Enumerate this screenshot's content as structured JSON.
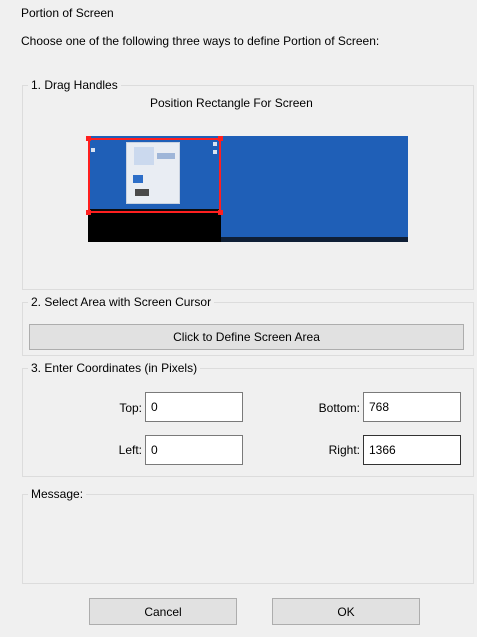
{
  "window": {
    "title": "Portion of Screen",
    "instruction": "Choose one of the following three ways to define Portion of Screen:"
  },
  "drag_handles": {
    "legend": "1. Drag Handles",
    "caption": "Position Rectangle For Screen"
  },
  "select_area": {
    "legend": "2. Select Area with Screen Cursor",
    "button_label": "Click to Define Screen Area"
  },
  "coordinates": {
    "legend": "3. Enter Coordinates (in Pixels)",
    "top_label": "Top:",
    "top_value": "0",
    "bottom_label": "Bottom:",
    "bottom_value": "768",
    "left_label": "Left:",
    "left_value": "0",
    "right_label": "Right:",
    "right_value": "1366"
  },
  "message": {
    "legend": "Message:"
  },
  "footer": {
    "cancel_label": "Cancel",
    "ok_label": "OK"
  },
  "colors": {
    "selection": "#ff1f1f",
    "desktop": "#1f5fb7"
  }
}
